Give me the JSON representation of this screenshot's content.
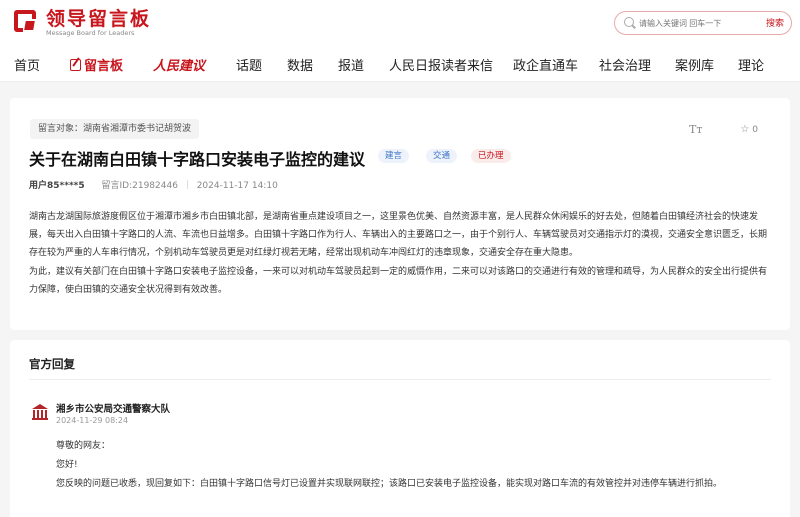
{
  "header": {
    "logo_cn": "领导留言板",
    "logo_en": "Message Board for Leaders",
    "search_placeholder": "请输入关键词 回车一下",
    "search_button": "搜索"
  },
  "nav": {
    "items": [
      "首页",
      "留言板",
      "人民建议",
      "话题",
      "数据",
      "报道",
      "人民日报读者来信",
      "政企直通车",
      "社会治理",
      "案例库",
      "理论"
    ]
  },
  "message": {
    "target_label": "留言对象：湖南省湘潭市委书记胡贺波",
    "title": "关于在湖南白田镇十字路口安装电子监控的建议",
    "tags": [
      "建言",
      "交通",
      "已办理"
    ],
    "font_toggle": "Tт",
    "favorite_count": "0",
    "user": "用户85****5",
    "message_id": "留言ID:21982446",
    "time": "2024-11-17 14:10",
    "paragraphs": [
      "湖南古龙湖国际旅游度假区位于湘潭市湘乡市白田镇北部，是湖南省重点建设项目之一，这里景色优美、自然资源丰富，是人民群众休闲娱乐的好去处，但随着白田镇经济社会的快速发展，每天出入白田镇十字路口的人流、车流也日益增多。白田镇十字路口作为行人、车辆出入的主要路口之一，由于个别行人、车辆驾驶员对交通指示灯的漠视，交通安全意识匮乏，长期存在较为严重的人车串行情况，个别机动车驾驶员更是对红绿灯视若无睹，经常出现机动车冲闯红灯的违章现象，交通安全存在重大隐患。",
      "为此，建议有关部门在白田镇十字路口安装电子监控设备，一来可以对机动车驾驶员起到一定的威慑作用，二来可以对该路口的交通进行有效的管理和疏导，为人民群众的安全出行提供有力保障，使白田镇的交通安全状况得到有效改善。"
    ]
  },
  "reply": {
    "heading": "官方回复",
    "org": "湘乡市公安局交通警察大队",
    "time": "2024-11-29 08:24",
    "lines": [
      "尊敬的网友：",
      "您好!",
      "您反映的问题已收悉，现回复如下：白田镇十字路口信号灯已设置并实现联网联控；该路口已安装电子监控设备，能实现对路口车流的有效管控并对违停车辆进行抓拍。"
    ]
  },
  "colors": {
    "brand": "#c8161d",
    "tag_blue": "#3a73c8",
    "page_bg": "#f5f5f5"
  }
}
